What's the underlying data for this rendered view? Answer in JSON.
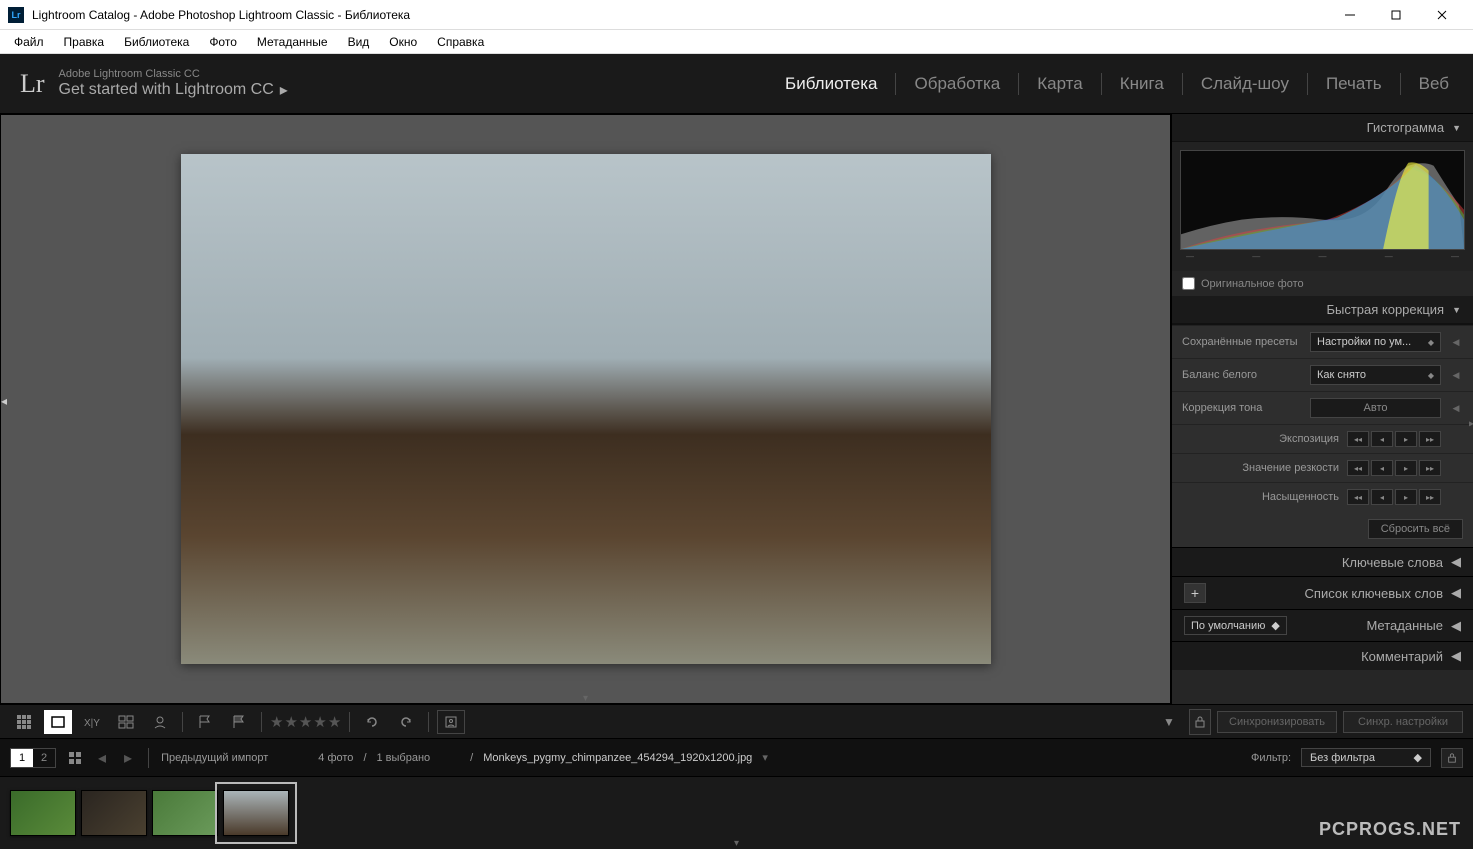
{
  "window": {
    "title": "Lightroom Catalog - Adobe Photoshop Lightroom Classic - Библиотека",
    "icon_text": "Lr"
  },
  "menu": {
    "items": [
      "Файл",
      "Правка",
      "Библиотека",
      "Фото",
      "Метаданные",
      "Вид",
      "Окно",
      "Справка"
    ]
  },
  "header": {
    "logo": "Lr",
    "subtitle_top": "Adobe Lightroom Classic CC",
    "subtitle_bottom": "Get started with Lightroom CC"
  },
  "modules": {
    "items": [
      "Библиотека",
      "Обработка",
      "Карта",
      "Книга",
      "Слайд-шоу",
      "Печать",
      "Веб"
    ],
    "active": 0
  },
  "right_panel": {
    "histogram_title": "Гистограмма",
    "original_photo_label": "Оригинальное фото",
    "quick_correction_title": "Быстрая коррекция",
    "saved_presets_label": "Сохранённые пресеты",
    "saved_presets_value": "Настройки по ум...",
    "white_balance_label": "Баланс белого",
    "white_balance_value": "Как снято",
    "tone_correction_label": "Коррекция тона",
    "auto_label": "Авто",
    "exposure_label": "Экспозиция",
    "sharpness_label": "Значение резкости",
    "saturation_label": "Насыщенность",
    "reset_all_label": "Сбросить всё",
    "keywords_title": "Ключевые слова",
    "keyword_list_title": "Список ключевых слов",
    "metadata_title": "Метаданные",
    "metadata_left_value": "По умолчанию",
    "comment_title": "Комментарий"
  },
  "toolbar": {
    "sync_label": "Синхронизировать",
    "sync_settings_label": "Синхр. настройки"
  },
  "filterbar": {
    "view1": "1",
    "view2": "2",
    "previous_import": "Предыдущий импорт",
    "photo_count": "4 фото",
    "selected_count": "1 выбрано",
    "filename": "Monkeys_pygmy_chimpanzee_454294_1920x1200.jpg",
    "filter_label": "Фильтр:",
    "filter_value": "Без фильтра"
  },
  "watermark": "PCPROGS.NET"
}
